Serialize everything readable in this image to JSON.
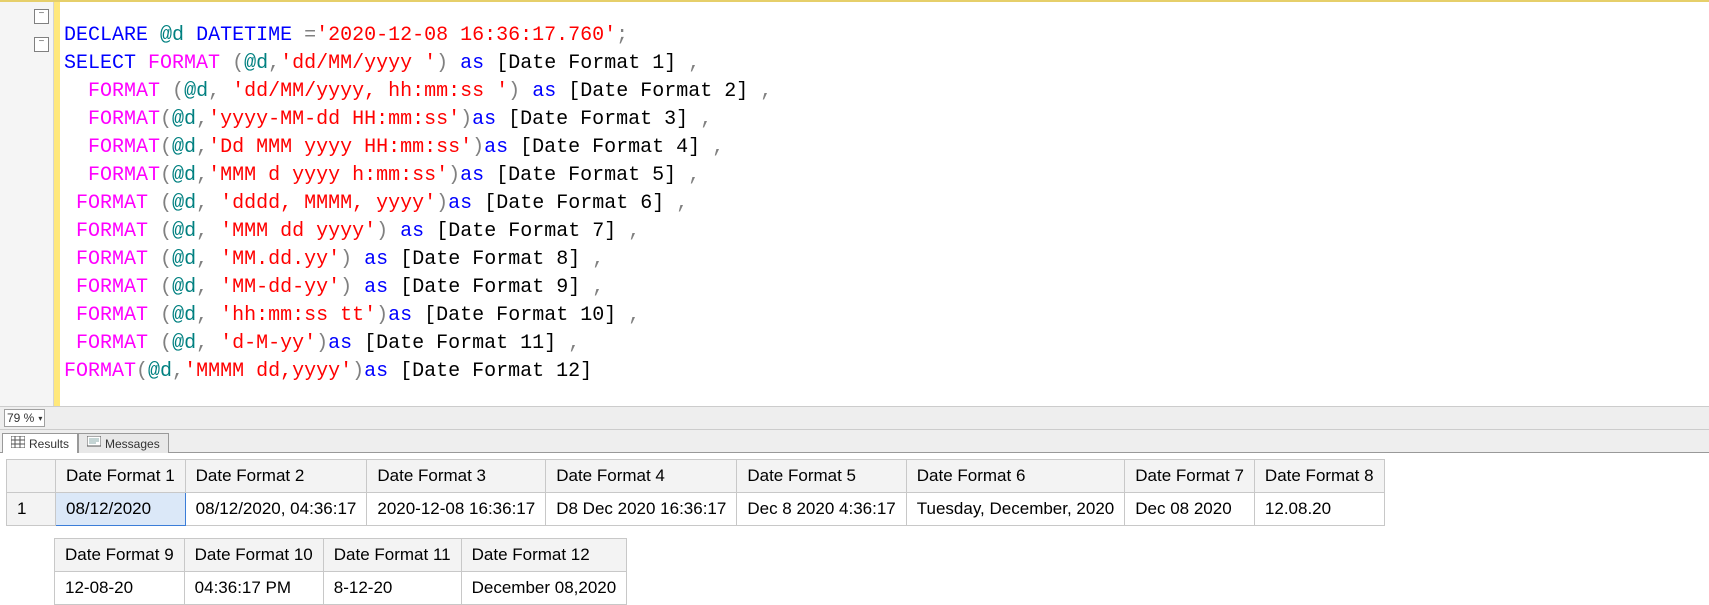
{
  "zoom": "79 %",
  "tabs": {
    "results": "Results",
    "messages": "Messages"
  },
  "code": {
    "l1": [
      [
        "kw",
        "DECLARE"
      ],
      [
        "id",
        " "
      ],
      [
        "var",
        "@d"
      ],
      [
        "id",
        " "
      ],
      [
        "kw",
        "DATETIME"
      ],
      [
        "id",
        " "
      ],
      [
        "pn",
        "="
      ],
      [
        "str",
        "'2020-12-08 16:36:17.760'"
      ],
      [
        "pn",
        ";"
      ]
    ],
    "l2": [
      [
        "kw",
        "SELECT"
      ],
      [
        "id",
        " "
      ],
      [
        "fn",
        "FORMAT"
      ],
      [
        "id",
        " "
      ],
      [
        "pn",
        "("
      ],
      [
        "var",
        "@d"
      ],
      [
        "pn",
        ","
      ],
      [
        "str",
        "'dd/MM/yyyy '"
      ],
      [
        "pn",
        ")"
      ],
      [
        "id",
        " "
      ],
      [
        "kw",
        "as"
      ],
      [
        "id",
        " [Date Format 1] "
      ],
      [
        "pn",
        ","
      ]
    ],
    "l3": [
      [
        "id",
        "  "
      ],
      [
        "fn",
        "FORMAT"
      ],
      [
        "id",
        " "
      ],
      [
        "pn",
        "("
      ],
      [
        "var",
        "@d"
      ],
      [
        "pn",
        ","
      ],
      [
        "id",
        " "
      ],
      [
        "str",
        "'dd/MM/yyyy, hh:mm:ss '"
      ],
      [
        "pn",
        ")"
      ],
      [
        "id",
        " "
      ],
      [
        "kw",
        "as"
      ],
      [
        "id",
        " [Date Format 2] "
      ],
      [
        "pn",
        ","
      ]
    ],
    "l4": [
      [
        "id",
        "  "
      ],
      [
        "fn",
        "FORMAT"
      ],
      [
        "pn",
        "("
      ],
      [
        "var",
        "@d"
      ],
      [
        "pn",
        ","
      ],
      [
        "str",
        "'yyyy-MM-dd HH:mm:ss'"
      ],
      [
        "pn",
        ")"
      ],
      [
        "kw",
        "as"
      ],
      [
        "id",
        " [Date Format 3] "
      ],
      [
        "pn",
        ","
      ]
    ],
    "l5": [
      [
        "id",
        "  "
      ],
      [
        "fn",
        "FORMAT"
      ],
      [
        "pn",
        "("
      ],
      [
        "var",
        "@d"
      ],
      [
        "pn",
        ","
      ],
      [
        "str",
        "'Dd MMM yyyy HH:mm:ss'"
      ],
      [
        "pn",
        ")"
      ],
      [
        "kw",
        "as"
      ],
      [
        "id",
        " [Date Format 4] "
      ],
      [
        "pn",
        ","
      ]
    ],
    "l6": [
      [
        "id",
        "  "
      ],
      [
        "fn",
        "FORMAT"
      ],
      [
        "pn",
        "("
      ],
      [
        "var",
        "@d"
      ],
      [
        "pn",
        ","
      ],
      [
        "str",
        "'MMM d yyyy h:mm:ss'"
      ],
      [
        "pn",
        ")"
      ],
      [
        "kw",
        "as"
      ],
      [
        "id",
        " [Date Format 5] "
      ],
      [
        "pn",
        ","
      ]
    ],
    "l7": [
      [
        "id",
        " "
      ],
      [
        "fn",
        "FORMAT"
      ],
      [
        "id",
        " "
      ],
      [
        "pn",
        "("
      ],
      [
        "var",
        "@d"
      ],
      [
        "pn",
        ","
      ],
      [
        "id",
        " "
      ],
      [
        "str",
        "'dddd, MMMM, yyyy'"
      ],
      [
        "pn",
        ")"
      ],
      [
        "kw",
        "as"
      ],
      [
        "id",
        " [Date Format 6] "
      ],
      [
        "pn",
        ","
      ]
    ],
    "l8": [
      [
        "id",
        " "
      ],
      [
        "fn",
        "FORMAT"
      ],
      [
        "id",
        " "
      ],
      [
        "pn",
        "("
      ],
      [
        "var",
        "@d"
      ],
      [
        "pn",
        ","
      ],
      [
        "id",
        " "
      ],
      [
        "str",
        "'MMM dd yyyy'"
      ],
      [
        "pn",
        ")"
      ],
      [
        "id",
        " "
      ],
      [
        "kw",
        "as"
      ],
      [
        "id",
        " [Date Format 7] "
      ],
      [
        "pn",
        ","
      ]
    ],
    "l9": [
      [
        "id",
        " "
      ],
      [
        "fn",
        "FORMAT"
      ],
      [
        "id",
        " "
      ],
      [
        "pn",
        "("
      ],
      [
        "var",
        "@d"
      ],
      [
        "pn",
        ","
      ],
      [
        "id",
        " "
      ],
      [
        "str",
        "'MM.dd.yy'"
      ],
      [
        "pn",
        ")"
      ],
      [
        "id",
        " "
      ],
      [
        "kw",
        "as"
      ],
      [
        "id",
        " [Date Format 8] "
      ],
      [
        "pn",
        ","
      ]
    ],
    "l10": [
      [
        "id",
        " "
      ],
      [
        "fn",
        "FORMAT"
      ],
      [
        "id",
        " "
      ],
      [
        "pn",
        "("
      ],
      [
        "var",
        "@d"
      ],
      [
        "pn",
        ","
      ],
      [
        "id",
        " "
      ],
      [
        "str",
        "'MM-dd-yy'"
      ],
      [
        "pn",
        ")"
      ],
      [
        "id",
        " "
      ],
      [
        "kw",
        "as"
      ],
      [
        "id",
        " [Date Format 9] "
      ],
      [
        "pn",
        ","
      ]
    ],
    "l11": [
      [
        "id",
        " "
      ],
      [
        "fn",
        "FORMAT"
      ],
      [
        "id",
        " "
      ],
      [
        "pn",
        "("
      ],
      [
        "var",
        "@d"
      ],
      [
        "pn",
        ","
      ],
      [
        "id",
        " "
      ],
      [
        "str",
        "'hh:mm:ss tt'"
      ],
      [
        "pn",
        ")"
      ],
      [
        "kw",
        "as"
      ],
      [
        "id",
        " [Date Format 10] "
      ],
      [
        "pn",
        ","
      ]
    ],
    "l12": [
      [
        "id",
        " "
      ],
      [
        "fn",
        "FORMAT"
      ],
      [
        "id",
        " "
      ],
      [
        "pn",
        "("
      ],
      [
        "var",
        "@d"
      ],
      [
        "pn",
        ","
      ],
      [
        "id",
        " "
      ],
      [
        "str",
        "'d-M-yy'"
      ],
      [
        "pn",
        ")"
      ],
      [
        "kw",
        "as"
      ],
      [
        "id",
        " [Date Format 11] "
      ],
      [
        "pn",
        ","
      ]
    ],
    "l13": [
      [
        "fn",
        "FORMAT"
      ],
      [
        "pn",
        "("
      ],
      [
        "var",
        "@d"
      ],
      [
        "pn",
        ","
      ],
      [
        "str",
        "'MMMM dd,yyyy'"
      ],
      [
        "pn",
        ")"
      ],
      [
        "kw",
        "as"
      ],
      [
        "id",
        " [Date Format 12]"
      ]
    ]
  },
  "results1": {
    "rownum": "1",
    "headers": [
      "Date Format 1",
      "Date Format 2",
      "Date Format 3",
      "Date Format 4",
      "Date Format 5",
      "Date Format 6",
      "Date Format 7",
      "Date Format 8"
    ],
    "row": [
      "08/12/2020",
      "08/12/2020, 04:36:17",
      "2020-12-08 16:36:17",
      "D8 Dec 2020 16:36:17",
      "Dec 8 2020 4:36:17",
      "Tuesday, December, 2020",
      "Dec 08 2020",
      "12.08.20"
    ]
  },
  "results2": {
    "headers": [
      "Date Format 9",
      "Date Format 10",
      "Date Format 11",
      "Date Format 12"
    ],
    "row": [
      "12-08-20",
      "04:36:17 PM",
      "8-12-20",
      "December 08,2020"
    ]
  }
}
